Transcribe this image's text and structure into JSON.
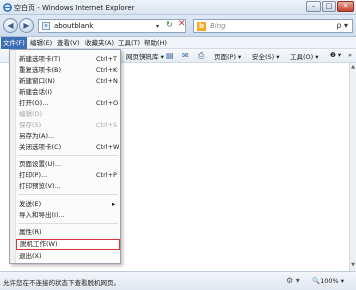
{
  "window": {
    "title": "空白页 - Windows Internet Explorer",
    "minimize_glyph": "–",
    "maximize_glyph": "□",
    "close_glyph": "✕"
  },
  "address_bar": {
    "back_glyph": "◀",
    "forward_glyph": "▶",
    "url": "aboutblank",
    "dropdown_glyph": "▾",
    "refresh_glyph": "↻",
    "stop_glyph": "✕",
    "search_placeholder": "Bing",
    "search_logo": "b",
    "search_glyph": "ρ ▾"
  },
  "menubar": {
    "items": [
      "文件(F)",
      "编辑(E)",
      "查看(V)",
      "收藏夹(A)",
      "工具(T)",
      "帮助(H)"
    ]
  },
  "toolbar": {
    "favorites_suffix": "网页快讯库 ▾",
    "page_label": "页面(P) ▾",
    "safety_label": "安全(S) ▾",
    "tools_label": "工具(O) ▾",
    "help_label": "❷ ▾",
    "more": "»"
  },
  "file_menu": {
    "items": [
      {
        "label": "新建选项卡(T)",
        "shortcut": "Ctrl+T",
        "disabled": false
      },
      {
        "label": "重复选项卡(B)",
        "shortcut": "Ctrl+K",
        "disabled": false
      },
      {
        "label": "新建窗口(N)",
        "shortcut": "Ctrl+N",
        "disabled": false
      },
      {
        "label": "新建会话(I)",
        "shortcut": "",
        "disabled": false
      },
      {
        "label": "打开(O)...",
        "shortcut": "Ctrl+O",
        "disabled": false
      },
      {
        "label": "编辑(D)",
        "shortcut": "",
        "disabled": true
      },
      {
        "label": "保存(S)",
        "shortcut": "Ctrl+S",
        "disabled": true
      },
      {
        "label": "另存为(A)...",
        "shortcut": "",
        "disabled": false
      },
      {
        "label": "关闭选项卡(C)",
        "shortcut": "Ctrl+W",
        "disabled": false
      },
      {
        "label": "页面设置(U)...",
        "shortcut": "",
        "disabled": false
      },
      {
        "label": "打印(P)...",
        "shortcut": "Ctrl+P",
        "disabled": false
      },
      {
        "label": "打印预览(V)...",
        "shortcut": "",
        "disabled": false
      },
      {
        "label": "发送(E)",
        "shortcut": "▸",
        "disabled": false
      },
      {
        "label": "导入和导出(I)...",
        "shortcut": "",
        "disabled": false
      },
      {
        "label": "属性(R)",
        "shortcut": "",
        "disabled": false
      },
      {
        "label": "脱机工作(W)",
        "shortcut": "",
        "disabled": false,
        "highlighted": true
      },
      {
        "label": "退出(X)",
        "shortcut": "",
        "disabled": false
      }
    ]
  },
  "status_bar": {
    "text": "允许您在不连接的状态下查看脱机网页。",
    "security_glyph": "⚙ ▾",
    "zoom": "🔍100% ▾"
  },
  "colors": {
    "menu_active": "#3b6fb6",
    "highlight_border": "#d9363e"
  }
}
